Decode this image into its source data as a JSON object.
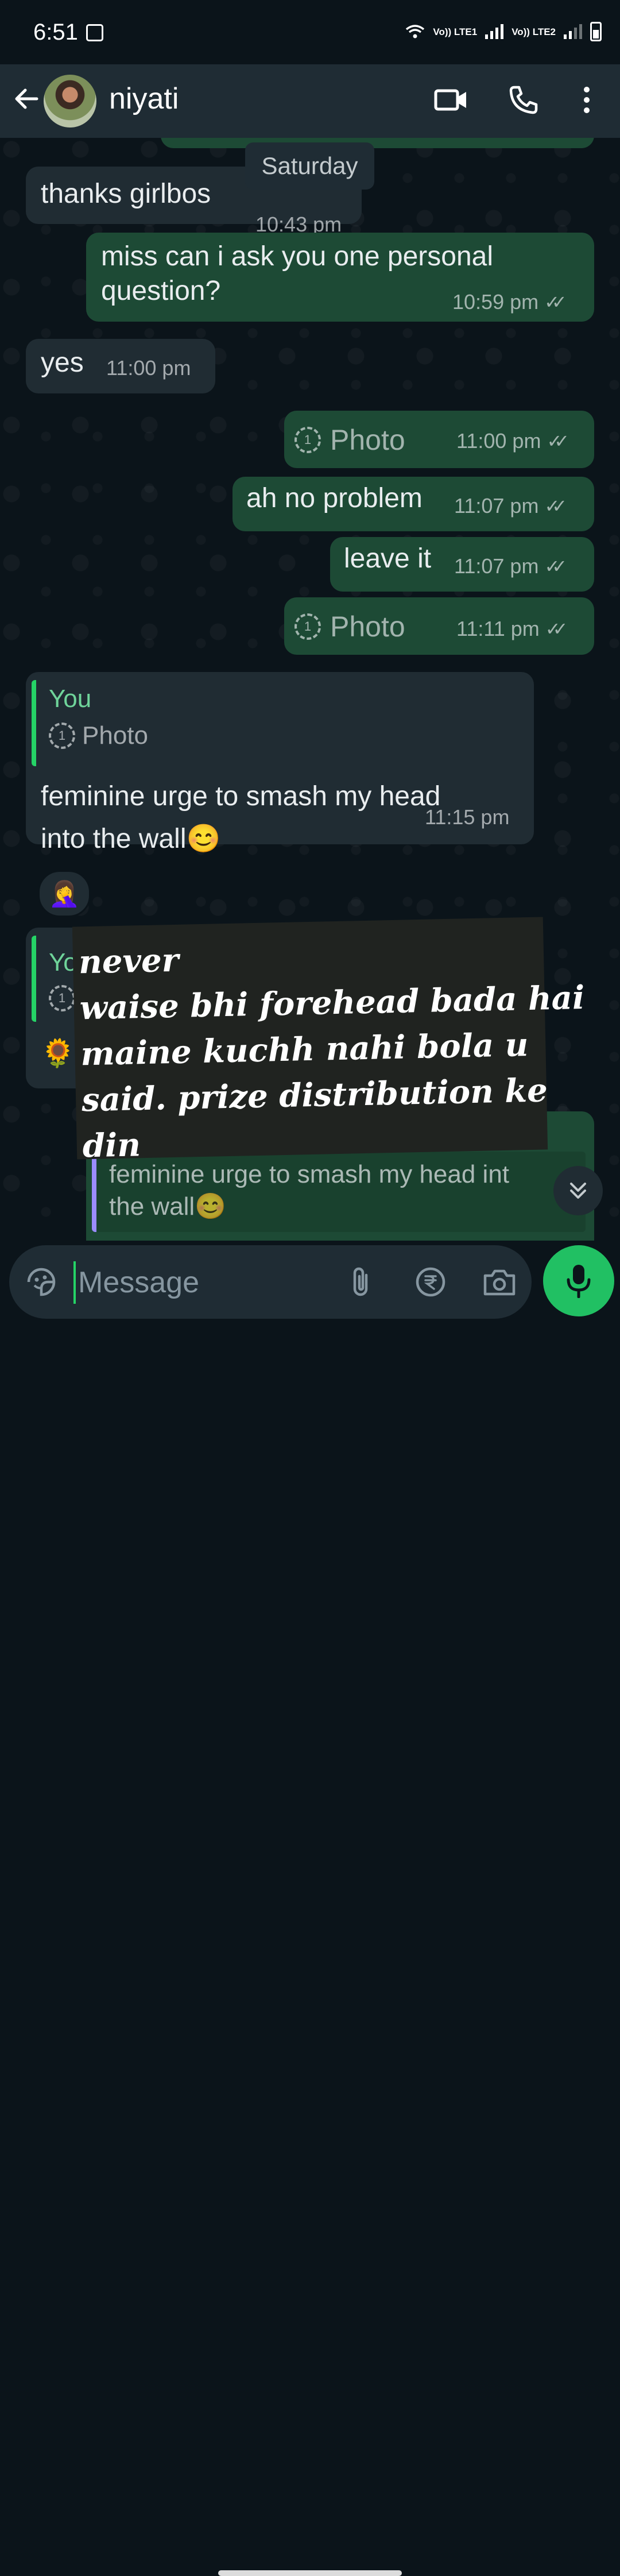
{
  "status_bar": {
    "time": "6:51",
    "sim1_label": "Vo)) LTE1",
    "sim2_label": "Vo)) LTE2"
  },
  "header": {
    "contact_name": "niyati",
    "back_icon": "arrow-left-icon",
    "video_icon": "video-camera-icon",
    "call_icon": "phone-icon",
    "menu_icon": "more-vertical-icon"
  },
  "chat": {
    "date_divider": "Saturday",
    "messages": [
      {
        "dir": "in",
        "text": "thanks girlbos",
        "time": "10:43 pm"
      },
      {
        "dir": "out",
        "text": "miss can i ask you one personal\nquestion?",
        "time": "10:59 pm"
      },
      {
        "dir": "in",
        "text": "yes",
        "time": "11:00 pm"
      },
      {
        "dir": "out",
        "type": "photo",
        "text": "Photo",
        "time": "11:00 pm"
      },
      {
        "dir": "out",
        "text": "ah no problem",
        "time": "11:07 pm"
      },
      {
        "dir": "out",
        "text": "leave it",
        "time": "11:07 pm"
      },
      {
        "dir": "out",
        "type": "photo",
        "text": "Photo",
        "time": "11:11 pm"
      },
      {
        "dir": "in",
        "reply_to_name": "You",
        "reply_to_text": "Photo",
        "text": "feminine urge to smash my head\ninto the wall😊",
        "time": "11:15 pm",
        "reaction": "🤦‍♀️"
      },
      {
        "dir": "in",
        "reply_to_name": "Yo",
        "reply_to_text": "",
        "text": "🌻",
        "time": ""
      },
      {
        "dir": "out",
        "reply_to_text": "feminine urge to smash my head int\nthe wall😊",
        "time": ""
      }
    ],
    "overlay_note_lines": [
      "never",
      "waise bhi forehead bada hai",
      "maine kuchh nahi bola u",
      "said. prize distribution ke",
      "din"
    ]
  },
  "composer": {
    "placeholder": "Message",
    "emoji_icon": "sticker-icon",
    "attach_icon": "paperclip-icon",
    "payment_icon": "rupee-icon",
    "camera_icon": "camera-icon",
    "mic_icon": "microphone-icon"
  },
  "colors": {
    "background": "#0b141a",
    "header": "#1f2c34",
    "incoming_bubble": "#202c33",
    "outgoing_bubble": "#1d4a35",
    "accent_green": "#21c063",
    "quote_name": "#6fd49a"
  }
}
